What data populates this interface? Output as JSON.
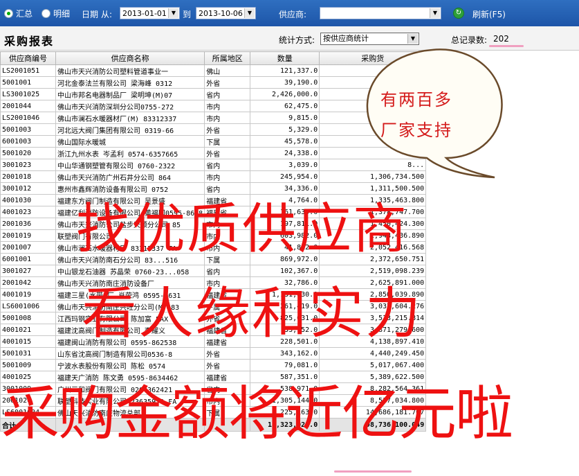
{
  "toolbar": {
    "radio_summary": "汇总",
    "radio_detail": "明细",
    "date_label": "日期",
    "from_label": "从:",
    "date_from": "2013-01-01",
    "to_label": "到",
    "date_to": "2013-10-06",
    "supplier_label": "供应商:",
    "supplier_value": "",
    "refresh_label": "刷新(F5)"
  },
  "header": {
    "title": "采购报表",
    "stat_label": "统计方式:",
    "stat_value": "按供应商统计",
    "total_label": "总记录数:",
    "total_value": "202"
  },
  "table": {
    "columns": [
      "供应商编号",
      "供应商名称",
      "所属地区",
      "数量",
      "采购货"
    ],
    "rows": [
      [
        "LS2001051",
        "佛山市天兴消防公司塑料管道事业一",
        "佛山",
        "121,337.0",
        ""
      ],
      [
        "5001001",
        "河北金泰法兰有限公司 梁海峰 0312",
        "外省",
        "39,190.0",
        ""
      ],
      [
        "LS3001025",
        "中山市邦名电器制品厂 梁明坤(M)07",
        "省内",
        "2,426,000.0",
        ""
      ],
      [
        "2001044",
        "佛山市天兴消防深圳分公司0755-272",
        "市内",
        "62,475.0",
        ""
      ],
      [
        "LS2001046",
        "佛山市澜石水暖器材厂(M) 83312337",
        "市内",
        "9,815.0",
        ""
      ],
      [
        "5001003",
        "河北远大阀门集团有限公司 0319-66",
        "外省",
        "5,329.0",
        ""
      ],
      [
        "6001003",
        "佛山国际水暖城",
        "下属",
        "45,578.0",
        ""
      ],
      [
        "5001020",
        "浙江九州水表 岑孟利 0574-6357665",
        "外省",
        "24,338.0",
        ""
      ],
      [
        "3001023",
        "中山华通钢塑管有限公司 0760-2322",
        "省内",
        "3,039.0",
        "8..."
      ],
      [
        "2001018",
        "佛山市天兴消防广州石井分公司 864",
        "市内",
        "245,954.0",
        "1,306,734.500"
      ],
      [
        "3001012",
        "惠州市鑫辉消防设备有限公司 0752",
        "省内",
        "34,336.0",
        "1,311,500.500"
      ],
      [
        "4001030",
        "福建东方阀门制造有限公司 吴景盛",
        "福建省",
        "4,764.0",
        "1,335,463.800"
      ],
      [
        "4001023",
        "福建亿利消防设备有限公司 黄福国0595-8628",
        "福建省",
        "161,639.0",
        "1,378,747.700"
      ],
      [
        "2001036",
        "佛山市天兴消防公司盐步天顺分公司 85",
        "市内",
        "197,811.0",
        "1,450,424.300"
      ],
      [
        "2001019",
        "联塑阀门有限公司",
        "市内",
        "603,982.0",
        "1,948,436.890"
      ],
      [
        "2001007",
        "佛山市澜石水暖器材厂 83312337 FA",
        "市内",
        "41,812.0",
        "2,052,416.568"
      ],
      [
        "6001001",
        "佛山市天兴消防南石分公司 83...516",
        "下属",
        "869,972.0",
        "2,372,650.751"
      ],
      [
        "3001027",
        "中山银龙石油器 苏晶荣 0760-23...058",
        "省内",
        "102,367.0",
        "2,519,098.239"
      ],
      [
        "2001042",
        "佛山市天兴消防南庄消防设备厂",
        "市内",
        "32,786.0",
        "2,625,891.000"
      ],
      [
        "4001019",
        "福建三星(水带)厂 肖荣鸿 0595-8631",
        "福建省",
        "1,131,630.0",
        "2,850,039.890"
      ],
      [
        "LS6001006",
        "佛山市天兴消防南庄兴旺分公司(M) 83",
        "下属",
        "261,419.0",
        "3,037,604.276"
      ],
      [
        "5001008",
        "江西玛钢实业有限公司 陈加富 FAX",
        "外省",
        "825,631.0",
        "3,513,215.814"
      ],
      [
        "4001021",
        "福建沈高阀门制造有限公司 李耀义",
        "福建省",
        "33,952.0",
        "3,871,279.600"
      ],
      [
        "4001015",
        "福建闽山消防有限公司 0595-862538",
        "福建省",
        "228,501.0",
        "4,138,897.410"
      ],
      [
        "5001031",
        "山东省沈高阀门制造有限公司0536-8",
        "外省",
        "343,162.0",
        "4,440,249.450"
      ],
      [
        "5001009",
        "宁波水表股份有限公司 陈松 0574",
        "外省",
        "79,081.0",
        "5,017,067.400"
      ],
      [
        "4001025",
        "福建天广消防 陈文勇 0595-8634462",
        "福建省",
        "587,351.0",
        "5,389,622.500"
      ],
      [
        "3001009",
        "广州三和阀门有限公司 020-362421",
        "省内",
        "538,971.0",
        "8,282,564.361"
      ],
      [
        "2001020",
        "联塑科技实业有限公司 23635970 FA",
        "市内",
        "1,305,144.0",
        "8,517,034.800"
      ],
      [
        "LS6001004",
        "佛山天兴消防南庄物流总部",
        "下属",
        "2,225,163.0",
        "14,686,181.707"
      ]
    ],
    "total": [
      "合计",
      "",
      "",
      "19,323,021.0",
      "98,736,100.049"
    ]
  },
  "bubble": {
    "line1": "有两百多",
    "line2": "厂家支持"
  },
  "overlay": {
    "line1": "找优质供应商",
    "line2": "看人缘和实力",
    "line3": "采购金额将近亿元啦"
  },
  "colors": {
    "toolbar": "#1d55a8",
    "overlay_red": "#ee1111",
    "bubble_text": "#d41a1a",
    "highlight_pink": "#f0a0c0"
  }
}
